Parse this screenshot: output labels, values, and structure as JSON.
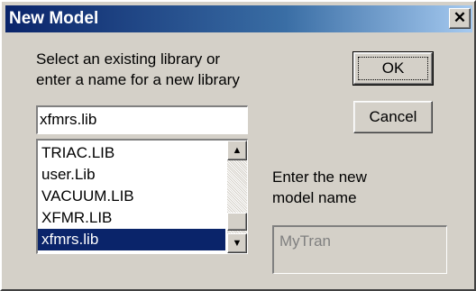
{
  "window": {
    "title": "New Model",
    "close_glyph": "✕"
  },
  "library": {
    "prompt": "Select an existing library or\nenter a name for a new library",
    "input_value": "xfmrs.lib",
    "list_items": [
      "TRIAC.LIB",
      "user.Lib",
      "VACUUM.LIB",
      "XFMR.LIB",
      "xfmrs.lib"
    ],
    "selected_item": "xfmrs.lib"
  },
  "buttons": {
    "ok_label": "OK",
    "cancel_label": "Cancel"
  },
  "model": {
    "prompt": "Enter the new\nmodel name",
    "input_value": "MyTran"
  },
  "scrollbar": {
    "up_icon": "▲",
    "down_icon": "▼"
  },
  "colors": {
    "title_start": "#0a246a",
    "title_end": "#a6caf0",
    "selection": "#0a246a",
    "face": "#d4d0c8"
  }
}
